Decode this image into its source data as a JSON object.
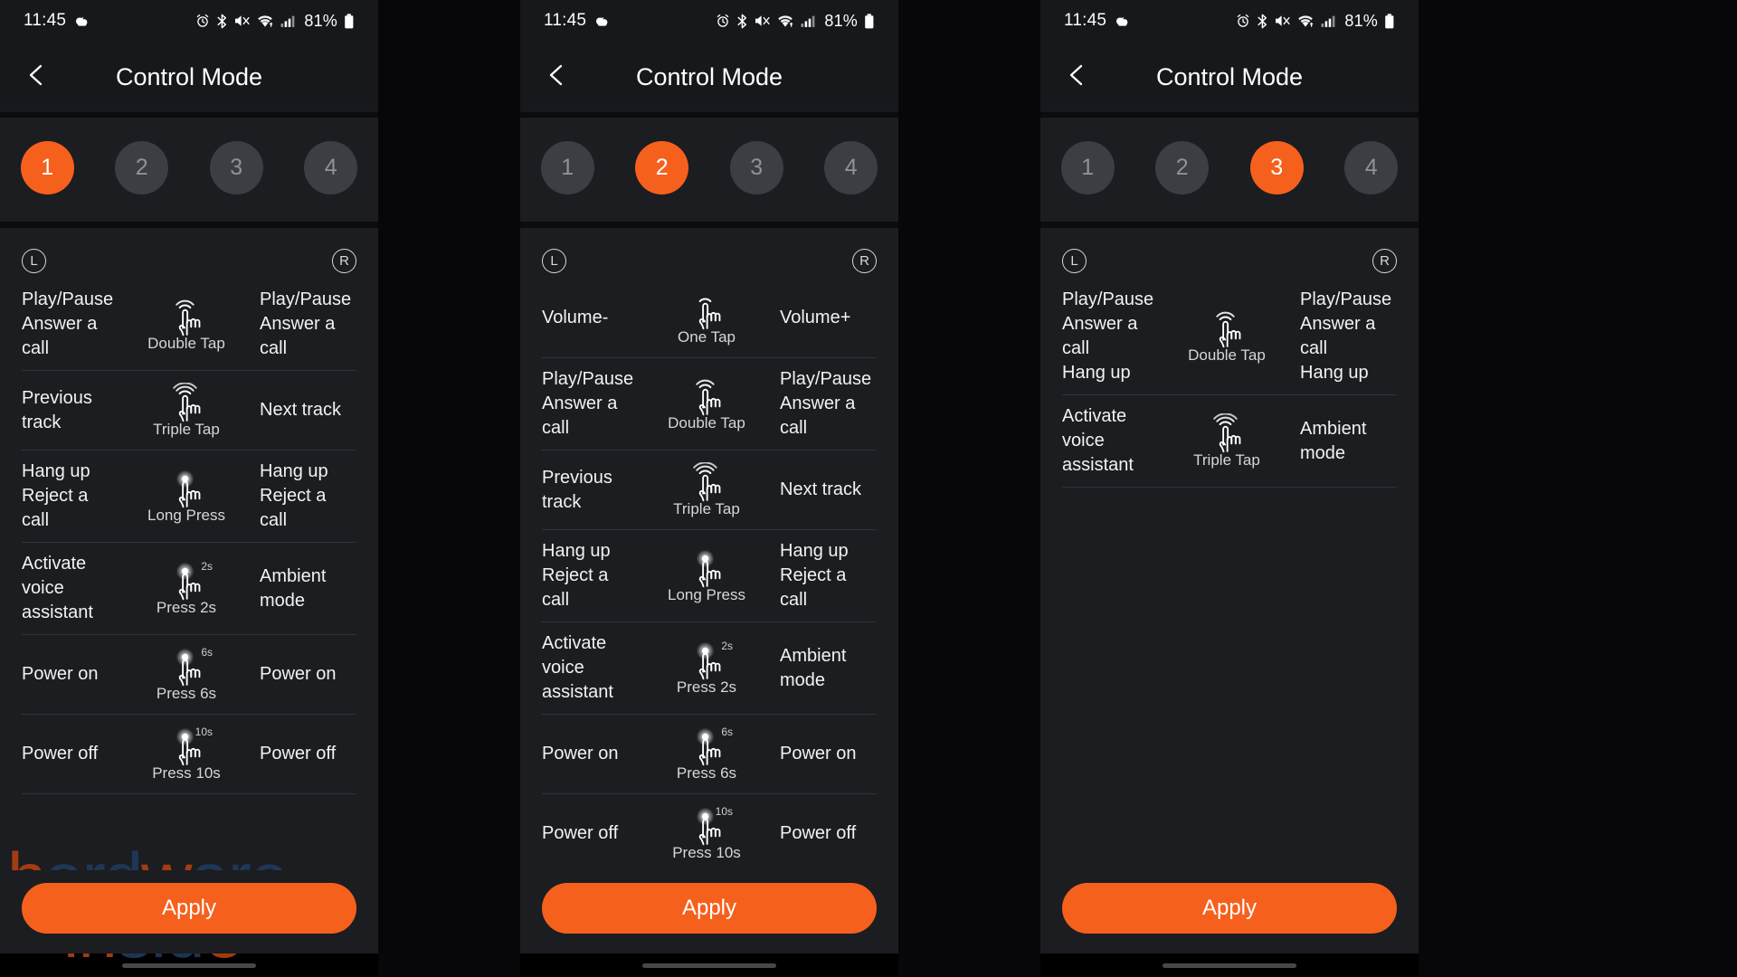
{
  "status_bar": {
    "time": "11:45",
    "battery_text": "81%",
    "left_icons": [
      "weather-cloud-icon"
    ],
    "right_icons": [
      "alarm-icon",
      "bluetooth-icon",
      "mute-icon",
      "wifi-icon",
      "signal-icon",
      "battery-icon"
    ]
  },
  "app_bar": {
    "back_icon": "chevron-left-icon",
    "title": "Control Mode"
  },
  "modes": [
    {
      "label": "1"
    },
    {
      "label": "2"
    },
    {
      "label": "3"
    },
    {
      "label": "4"
    }
  ],
  "headers": {
    "left": "L",
    "right": "R"
  },
  "apply_label": "Apply",
  "colors": {
    "accent": "#f6601d",
    "panel_bg": "#1b1d21",
    "bar_bg": "#16181c",
    "pill_inactive": "#3b3e43",
    "divider": "#303237",
    "text": "#f2f2f3",
    "muted": "#8f9297"
  },
  "watermark": {
    "line1": "hardware",
    "line2": "inside"
  },
  "panels": [
    {
      "active_mode": "1",
      "rows": [
        {
          "left": "Play/Pause\nAnswer a call",
          "gesture": "Double Tap",
          "gesture_type": "tap2",
          "duration": "",
          "right": "Play/Pause\nAnswer a call"
        },
        {
          "left": "Previous track",
          "gesture": "Triple Tap",
          "gesture_type": "tap3",
          "duration": "",
          "right": "Next track"
        },
        {
          "left": "Hang up\nReject a call",
          "gesture": "Long Press",
          "gesture_type": "press",
          "duration": "",
          "right": "Hang up\nReject a call"
        },
        {
          "left": "Activate\nvoice\nassistant",
          "gesture": "Press 2s",
          "gesture_type": "press",
          "duration": "2s",
          "right": "Ambient mode"
        },
        {
          "left": "Power on",
          "gesture": "Press 6s",
          "gesture_type": "press",
          "duration": "6s",
          "right": "Power on"
        },
        {
          "left": "Power off",
          "gesture": "Press 10s",
          "gesture_type": "press",
          "duration": "10s",
          "right": "Power off"
        }
      ]
    },
    {
      "active_mode": "2",
      "rows": [
        {
          "left": "Volume-",
          "gesture": "One Tap",
          "gesture_type": "tap1",
          "duration": "",
          "right": "Volume+"
        },
        {
          "left": "Play/Pause\nAnswer a call",
          "gesture": "Double Tap",
          "gesture_type": "tap2",
          "duration": "",
          "right": "Play/Pause\nAnswer a call"
        },
        {
          "left": "Previous track",
          "gesture": "Triple Tap",
          "gesture_type": "tap3",
          "duration": "",
          "right": "Next track"
        },
        {
          "left": "Hang up\nReject a call",
          "gesture": "Long Press",
          "gesture_type": "press",
          "duration": "",
          "right": "Hang up\nReject a call"
        },
        {
          "left": "Activate\nvoice\nassistant",
          "gesture": "Press 2s",
          "gesture_type": "press",
          "duration": "2s",
          "right": "Ambient mode"
        },
        {
          "left": "Power on",
          "gesture": "Press 6s",
          "gesture_type": "press",
          "duration": "6s",
          "right": "Power on"
        },
        {
          "left": "Power off",
          "gesture": "Press 10s",
          "gesture_type": "press",
          "duration": "10s",
          "right": "Power off"
        }
      ]
    },
    {
      "active_mode": "3",
      "rows": [
        {
          "left": "Play/Pause\nAnswer a call\nHang up",
          "gesture": "Double Tap",
          "gesture_type": "tap2",
          "duration": "",
          "right": "Play/Pause\nAnswer a call\nHang up"
        },
        {
          "left": "Activate\nvoice\nassistant",
          "gesture": "Triple Tap",
          "gesture_type": "tap3",
          "duration": "",
          "right": "Ambient mode"
        }
      ]
    }
  ]
}
